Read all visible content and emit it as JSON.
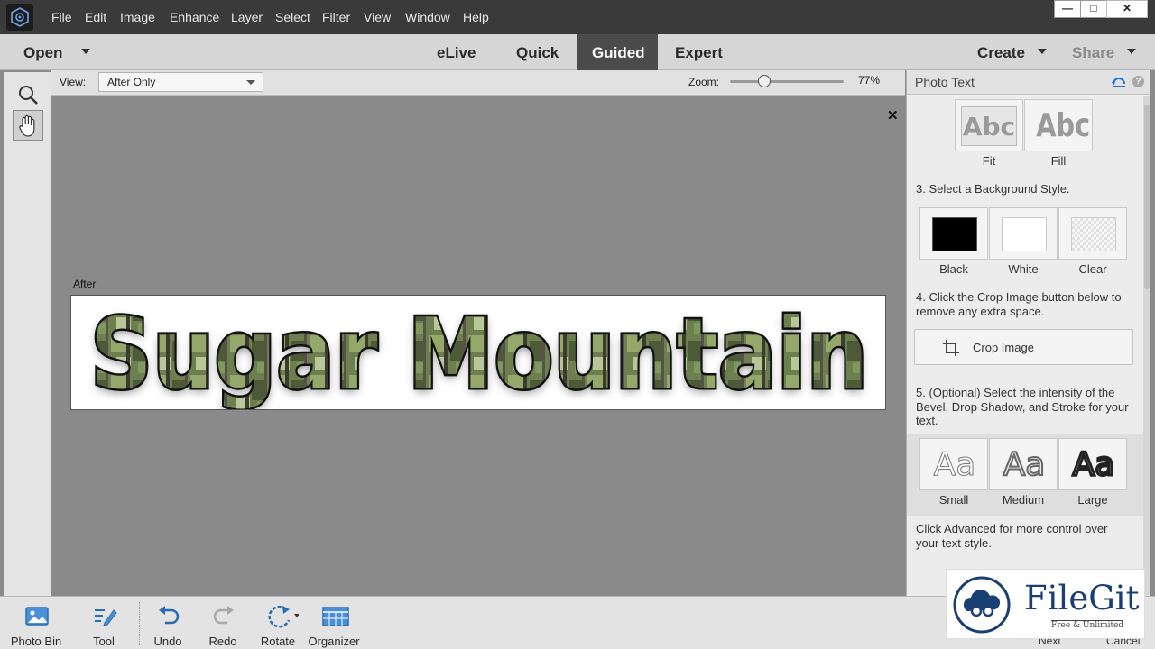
{
  "menubar": {
    "items": [
      "File",
      "Edit",
      "Image",
      "Enhance",
      "Layer",
      "Select",
      "Filter",
      "View",
      "Window",
      "Help"
    ],
    "window_controls": [
      "—",
      "□",
      "✕"
    ]
  },
  "modebar": {
    "open_label": "Open",
    "tabs": [
      "eLive",
      "Quick",
      "Guided",
      "Expert"
    ],
    "active_tab": "Guided",
    "create_label": "Create",
    "share_label": "Share"
  },
  "viewbar": {
    "view_label": "View:",
    "view_value": "After Only",
    "zoom_label": "Zoom:",
    "zoom_value": "77%",
    "zoom_fraction": 0.3
  },
  "canvas": {
    "close_glyph": "✕",
    "after_label": "After",
    "image_text": "Sugar Mountain"
  },
  "panel": {
    "title": "Photo Text",
    "fit_fill": [
      {
        "label": "Fit",
        "glyph": "Abc"
      },
      {
        "label": "Fill",
        "glyph": "Abc"
      }
    ],
    "step3": "3. Select a Background Style.",
    "backgrounds": [
      {
        "label": "Black",
        "color": "#000000"
      },
      {
        "label": "White",
        "color": "#ffffff"
      },
      {
        "label": "Clear",
        "color": "#f2f2f2"
      }
    ],
    "step4_line1": "4. Click the Crop Image button below to",
    "step4_line2": "remove any extra space.",
    "crop_label": "Crop Image",
    "step5_line1": "5. (Optional) Select the intensity of the",
    "step5_line2": "Bevel, Drop Shadow, and Stroke for your",
    "step5_line3": "text.",
    "intensities": [
      {
        "label": "Small",
        "glyph": "Aa"
      },
      {
        "label": "Medium",
        "glyph": "Aa"
      },
      {
        "label": "Large",
        "glyph": "Aa"
      }
    ],
    "advanced_line1": "Click Advanced for more control over",
    "advanced_line2": "your text style."
  },
  "bottombar": {
    "items": [
      "Photo Bin",
      "Tool Options",
      "Undo",
      "Redo",
      "Rotate",
      "Organizer"
    ],
    "next_label": "Next",
    "cancel_label": "Cancel"
  },
  "watermark": {
    "brand": "FileGit",
    "tagline": "Free & Unlimited"
  },
  "colors": {
    "menubar_bg": "#3a3a3a",
    "active_tab_bg": "#4b4b4b",
    "accent": "#1473e6"
  }
}
